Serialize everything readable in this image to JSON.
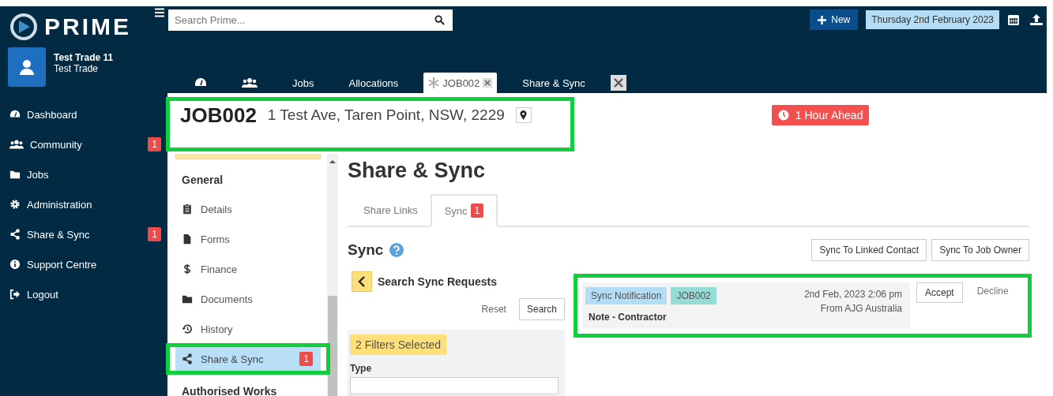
{
  "logo": {
    "text": "PRIME"
  },
  "user": {
    "name": "Test Trade 11",
    "role": "Test Trade"
  },
  "sidebar": {
    "items": [
      {
        "label": "Dashboard"
      },
      {
        "label": "Community",
        "badge": "1"
      },
      {
        "label": "Jobs"
      },
      {
        "label": "Administration"
      },
      {
        "label": "Share & Sync",
        "badge": "1"
      },
      {
        "label": "Support Centre"
      },
      {
        "label": "Logout"
      }
    ]
  },
  "search": {
    "placeholder": "Search Prime..."
  },
  "new_button": "New",
  "date": "Thursday 2nd February 2023",
  "tabs": [
    {
      "kind": "dashboard",
      "selected": false
    },
    {
      "kind": "people",
      "selected": false
    },
    {
      "kind": "text",
      "label": "Jobs",
      "selected": false
    },
    {
      "kind": "text",
      "label": "Allocations",
      "selected": false
    },
    {
      "kind": "job",
      "label": "JOB002",
      "selected": true
    },
    {
      "kind": "text",
      "label": "Share & Sync",
      "selected": false
    }
  ],
  "job": {
    "number": "JOB002",
    "address": "1 Test Ave, Taren Point, NSW, 2229",
    "highlighted": true
  },
  "time_badge": "1 Hour Ahead",
  "section_nav": {
    "heading": "General",
    "items": [
      {
        "label": "Details",
        "selected": false,
        "highlighted": false
      },
      {
        "label": "Forms",
        "selected": false,
        "highlighted": false
      },
      {
        "label": "Finance",
        "selected": false,
        "highlighted": false
      },
      {
        "label": "Documents",
        "selected": false,
        "highlighted": false
      },
      {
        "label": "History",
        "selected": false,
        "highlighted": false
      },
      {
        "label": "Share & Sync",
        "selected": true,
        "highlighted": true,
        "badge": "1"
      }
    ],
    "next_heading": "Authorised Works"
  },
  "page_title": "Share & Sync",
  "page_tabs": [
    {
      "label": "Share Links",
      "selected": false
    },
    {
      "label": "Sync",
      "selected": true,
      "badge": "1"
    }
  ],
  "sync": {
    "title": "Sync",
    "actions": [
      "Sync To Linked Contact",
      "Sync To Job Owner"
    ]
  },
  "filters": {
    "title": "Search Sync Requests",
    "reset": "Reset",
    "search": "Search",
    "selected_count": "2 Filters Selected",
    "type_label": "Type"
  },
  "requests": [
    {
      "tags": [
        {
          "label": "Sync Notification",
          "color": "#b3dcf5"
        },
        {
          "label": "JOB002",
          "color": "#95dcd6"
        }
      ],
      "date": "2nd Feb, 2023 2:06 pm",
      "from": "From AJG Australia",
      "title": "Note - Contractor",
      "accept": "Accept",
      "decline": "Decline",
      "highlighted": true
    }
  ]
}
